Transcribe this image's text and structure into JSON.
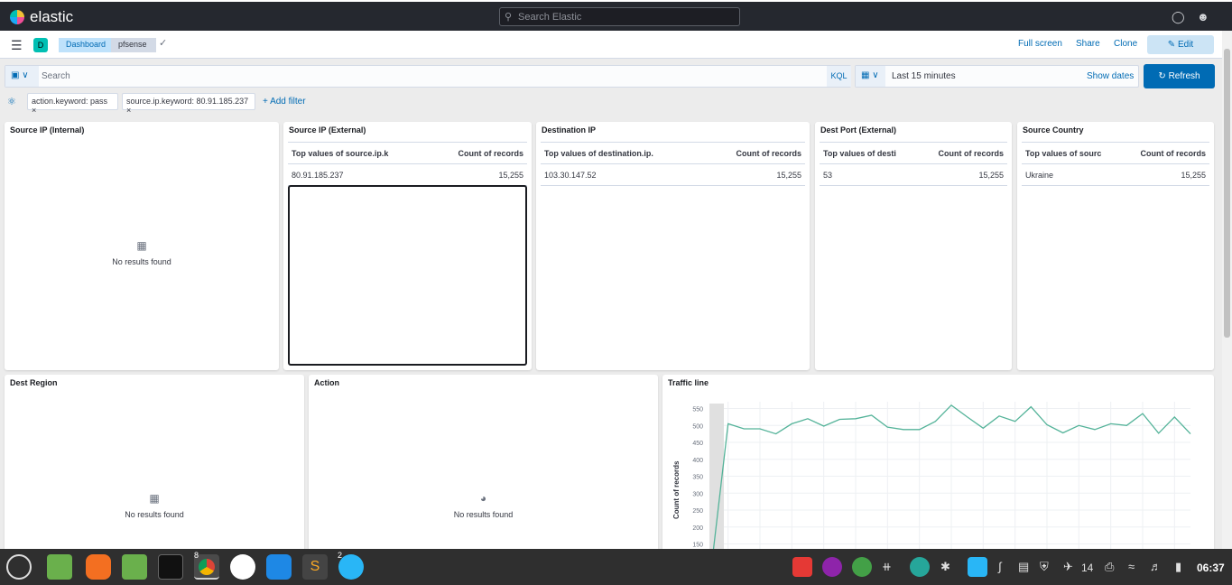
{
  "topbar": {
    "brand": "elastic",
    "search_placeholder": "Search Elastic"
  },
  "nav": {
    "menu_icon": "hamburger-icon",
    "space_badge": "D",
    "breadcrumbs": [
      "Dashboard",
      "pfsense"
    ],
    "links": [
      "Full screen",
      "Share",
      "Clone"
    ],
    "edit_label": "Edit"
  },
  "query": {
    "placeholder": "Search",
    "language": "KQL",
    "time_range": "Last 15 minutes",
    "show_dates": "Show dates",
    "refresh_label": "Refresh"
  },
  "filters": {
    "pills": [
      "action.keyword: pass",
      "source.ip.keyword: 80.91.185.237"
    ],
    "add_label": "+ Add filter"
  },
  "panels": {
    "source_internal": {
      "title": "Source IP (Internal)",
      "empty": "No results found"
    },
    "source_external": {
      "title": "Source IP (External)",
      "col1": "Top values of source.ip.k",
      "col2": "Count of records",
      "row": [
        "80.91.185.237",
        "15,255"
      ]
    },
    "destination": {
      "title": "Destination IP",
      "col1": "Top values of destination.ip.",
      "col2": "Count of records",
      "row": [
        "103.30.147.52",
        "15,255"
      ]
    },
    "dest_port": {
      "title": "Dest Port (External)",
      "col1": "Top values of desti",
      "col2": "Count of records",
      "row": [
        "53",
        "15,255"
      ]
    },
    "source_country": {
      "title": "Source Country",
      "col1": "Top values of sourc",
      "col2": "Count of records",
      "row": [
        "Ukraine",
        "15,255"
      ]
    },
    "dest_region": {
      "title": "Dest Region",
      "empty": "No results found"
    },
    "action": {
      "title": "Action",
      "empty": "No results found"
    },
    "traffic": {
      "title": "Traffic line"
    }
  },
  "chart_data": {
    "type": "line",
    "title": "Traffic line",
    "ylabel": "Count of records",
    "yticks": [
      150,
      200,
      250,
      300,
      350,
      400,
      450,
      500,
      550
    ],
    "ylim": [
      90,
      570
    ],
    "values": [
      100,
      505,
      490,
      490,
      475,
      505,
      520,
      498,
      518,
      520,
      530,
      495,
      488,
      488,
      512,
      560,
      525,
      492,
      528,
      512,
      555,
      502,
      478,
      500,
      488,
      505,
      500,
      535,
      477,
      525,
      475
    ],
    "line_color": "#54b399",
    "grid": true
  },
  "taskbar": {
    "clock": "06:37",
    "tray_count": "14",
    "chrome_badge": "8",
    "app_badge": "2"
  }
}
